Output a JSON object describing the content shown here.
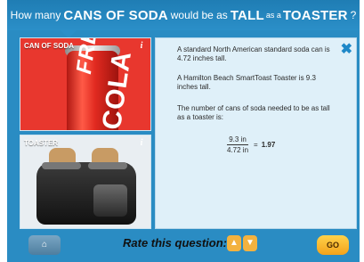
{
  "header": {
    "part1": "How many",
    "part2": "CANS OF SODA",
    "part3": "would be as",
    "part4": "TALL",
    "part5": "as a",
    "part6": "TOASTER",
    "part7": "?"
  },
  "cards": [
    {
      "label": "CAN OF SODA",
      "info_icon": "info-icon"
    },
    {
      "label": "TOASTER",
      "info_icon": "info-icon"
    }
  ],
  "can_art": {
    "text1": "FRESH",
    "text2": "COLA"
  },
  "panel": {
    "close_icon": "close-icon",
    "p1": "A standard North American standard soda can is 4.72 inches tall.",
    "p2": "A Hamilton Beach SmartToast Toaster is 9.3 inches tall.",
    "p3": "The number of cans of soda needed to be as tall as a toaster is:",
    "numerator": "9.3 in",
    "denominator": "4.72 in",
    "equals": "=",
    "result": "1.97"
  },
  "footer": {
    "home_icon": "home-icon",
    "rate_label": "Rate this question:",
    "thumb_up_icon": "thumbs-up-icon",
    "thumb_down_icon": "thumbs-down-icon",
    "go_label": "GO"
  },
  "colors": {
    "frame": "#2a8cc3",
    "panel": "#dff0f9",
    "accent": "#1e88c8",
    "go": "#f3a21b"
  }
}
